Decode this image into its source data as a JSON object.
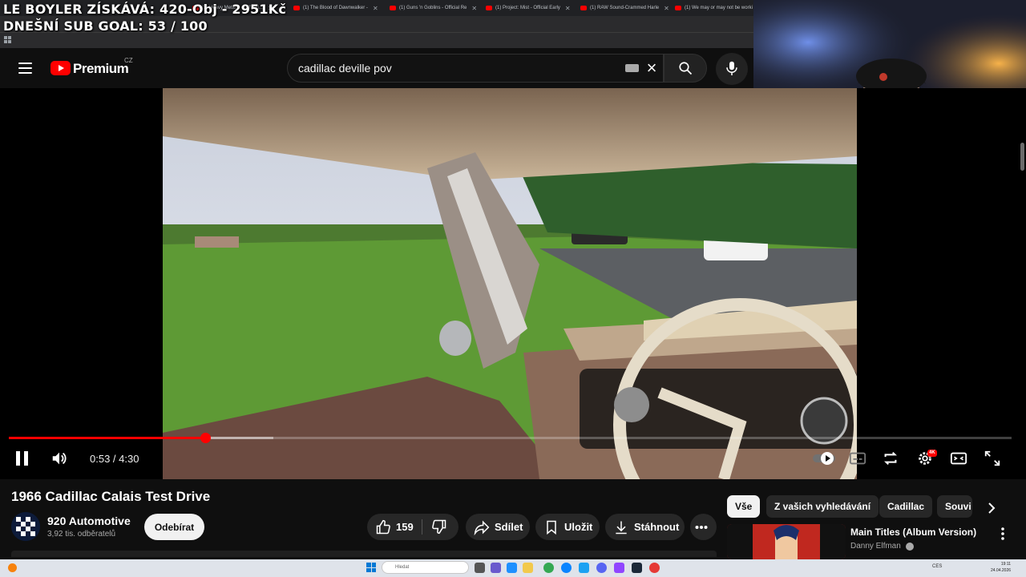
{
  "browser": {
    "tabs": [
      {
        "label": "(1) Heavy Metal 2 - Official..."
      },
      {
        "label": "(1) The Blood of Dawnwalker -"
      },
      {
        "label": "(1) Guns 'n Goblins - Official Re"
      },
      {
        "label": "(1) Project: Mist - Official Early"
      },
      {
        "label": "(1) RAW Sound-Crammed Harle"
      },
      {
        "label": "(1) We may or may not be worki"
      }
    ]
  },
  "overlay": {
    "line1": "LE BOYLER ZÍSKÁVÁ: 420-Obj - 2951Kč",
    "line2": "DNEŠNÍ SUB GOAL: 53 / 100"
  },
  "masthead": {
    "logo_text": "Premium",
    "country": "CZ",
    "search_value": "cadillac deville pov",
    "icons": [
      "menu-icon",
      "keyboard-icon",
      "close-icon",
      "search-icon",
      "mic-icon"
    ]
  },
  "player": {
    "time": "0:53 / 4:30",
    "progress_fraction": 0.196,
    "buttons": [
      "pause-icon",
      "volume-icon",
      "autoplay-toggle",
      "subtitles-icon",
      "loop-icon",
      "settings-icon",
      "theater-icon",
      "fullscreen-icon"
    ],
    "settings_badge": "4K"
  },
  "video": {
    "title": "1966 Cadillac Calais Test Drive",
    "channel": "920 Automotive",
    "subscribers": "3,92 tis. odběratelů",
    "subscribe_label": "Odebírat",
    "likes": "159",
    "share_label": "Sdílet",
    "save_label": "Uložit",
    "download_label": "Stáhnout"
  },
  "chips": [
    {
      "label": "Vše",
      "active": true
    },
    {
      "label": "Z vašich vyhledávání",
      "active": false
    },
    {
      "label": "Cadillac",
      "active": false
    },
    {
      "label": "Souvi",
      "active": false
    }
  ],
  "related": {
    "title": "Main Titles (Album Version)",
    "artist": "Danny Elfman"
  },
  "taskbar": {
    "search_placeholder": "Hledat",
    "tray_lang": "CES",
    "clock_time": "19:11",
    "clock_date": "24.04.2026"
  },
  "colors": {
    "accent": "#ff0000",
    "background": "#0f0f0f",
    "chip_bg": "#272727"
  }
}
